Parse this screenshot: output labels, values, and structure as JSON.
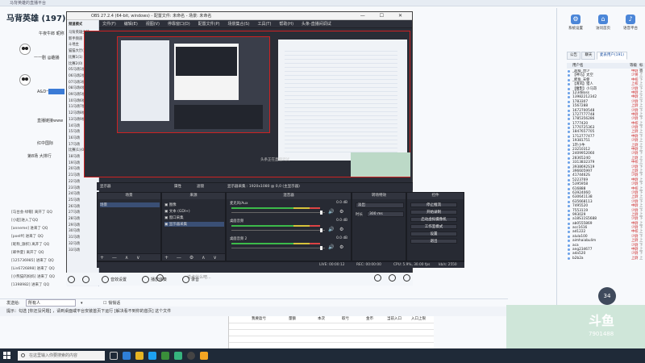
{
  "chat": {
    "window_title": "马背英雄的直播平台",
    "room_title": "马背英雄 (197)",
    "messages": [
      "午夜牛郎 昵称",
      "一一剧 @趣播",
      "A&D一剧",
      "直播链接www",
      "红中国际",
      "第8场 大排行"
    ],
    "logs": [
      "[马台会·绿帽] 离开了 QQ",
      "[小超]进入了QQ",
      "[anneme] 进来了 QQ",
      "[poelff] 进来了 QQ",
      "[昵称_旗帜] 离开了 QQ",
      "[邮件夏] 离开了 QQ",
      "[125736985] 进来了 QQ",
      "[Lin6726898] 进来了 QQ",
      "[小熊猫的妈妈] 进来了 QQ",
      "[1398982] 进来了 QQ"
    ],
    "send_to_label": "发送给:",
    "send_to_value": "所有人",
    "private_label": "悄悄话",
    "tip": "提示：勾选 [你还没问题] ，请到桌面或平台安装首页下运行 [解决看不到你的首页] 这个文件",
    "input_placeholder": "说点什么吧..."
  },
  "toolbar": {
    "tools": [
      "表情",
      "图片",
      "截屏",
      "礼物",
      "麦克风",
      "音效设置",
      "播放伴奏",
      "录音"
    ]
  },
  "right_panel": {
    "icons": [
      "系统设置",
      "访问首页",
      "语音平台"
    ],
    "tabs": [
      "公告",
      "聊天",
      "麦表用户(191)"
    ],
    "headers": [
      "用户名",
      "等级",
      "标签"
    ],
    "users": [
      {
        "name": "_超级_昆少",
        "level": "中尉",
        "tag": "上"
      },
      {
        "name": "【神马】太空",
        "level": "少将",
        "tag": "上"
      },
      {
        "name": "_鳄鱼_天使",
        "level": "中校",
        "tag": "下"
      },
      {
        "name": "【清风】猎人",
        "level": "上校",
        "tag": "上"
      },
      {
        "name": "【魔影】小马哥",
        "level": "少尉",
        "tag": "下"
      },
      {
        "name": "1234Boss",
        "level": "中尉",
        "tag": "上"
      },
      {
        "name": "13982212342",
        "level": "中尉",
        "tag": "上"
      },
      {
        "name": "1783307",
        "level": "少尉",
        "tag": "下"
      },
      {
        "name": "1567288",
        "level": "上尉",
        "tag": "上"
      },
      {
        "name": "1672700548",
        "level": "少尉",
        "tag": "下"
      },
      {
        "name": "1727777748",
        "level": "中尉",
        "tag": "上"
      },
      {
        "name": "1785356286",
        "level": "少尉",
        "tag": "下"
      },
      {
        "name": "1777420",
        "level": "中校",
        "tag": "上"
      },
      {
        "name": "1770725363",
        "level": "少尉",
        "tag": "下"
      },
      {
        "name": "1847657705",
        "level": "上尉",
        "tag": "上"
      },
      {
        "name": "1712777477",
        "level": "中尉",
        "tag": "下"
      },
      {
        "name": "19381751",
        "level": "少尉",
        "tag": "上"
      },
      {
        "name": "1吓小牛",
        "level": "上尉",
        "tag": "上"
      },
      {
        "name": "23210312",
        "level": "中尉",
        "tag": "上"
      },
      {
        "name": "2409952060",
        "level": "少尉",
        "tag": "下"
      },
      {
        "name": "2836524O",
        "level": "上尉",
        "tag": "上"
      },
      {
        "name": "3313832379",
        "level": "中校",
        "tag": "上"
      },
      {
        "name": "3938692S19",
        "level": "少尉",
        "tag": "下"
      },
      {
        "name": "396605997",
        "level": "上尉",
        "tag": "上"
      },
      {
        "name": "4174462S",
        "level": "少尉",
        "tag": "下"
      },
      {
        "name": "5223769",
        "level": "中尉",
        "tag": "上"
      },
      {
        "name": "5395958",
        "level": "少尉",
        "tag": "下"
      },
      {
        "name": "616888",
        "level": "中校",
        "tag": "上"
      },
      {
        "name": "6392406O",
        "level": "少尉",
        "tag": "下"
      },
      {
        "name": "630641138",
        "level": "上尉",
        "tag": "上"
      },
      {
        "name": "635668113",
        "level": "少尉",
        "tag": "下"
      },
      {
        "name": "7495520",
        "level": "中尉",
        "tag": "上"
      },
      {
        "name": "7553119",
        "level": "少尉",
        "tag": "下"
      },
      {
        "name": "993029",
        "level": "上尉",
        "tag": "上"
      },
      {
        "name": "a18S11S5688",
        "level": "少尉",
        "tag": "下"
      },
      {
        "name": "ab0555869",
        "level": "中尉",
        "tag": "上"
      },
      {
        "name": "acc1616",
        "level": "少尉",
        "tag": "下"
      },
      {
        "name": "ad1222",
        "level": "中校",
        "tag": "上"
      },
      {
        "name": "alula100",
        "level": "少尉",
        "tag": "下"
      },
      {
        "name": "aimhaiabulim",
        "level": "上尉",
        "tag": "上"
      },
      {
        "name": "aca",
        "level": "少尉",
        "tag": "下"
      },
      {
        "name": "ang234677",
        "level": "中尉",
        "tag": "上"
      },
      {
        "name": "ada520",
        "level": "少尉",
        "tag": "下"
      },
      {
        "name": "b2b2a",
        "level": "上尉",
        "tag": "上"
      }
    ],
    "float_avatar": "34"
  },
  "obs": {
    "title": "OBS 27.2.4 (64-bit, windows) - 配置文件: 未命名 - 场景: 未命名",
    "menus": [
      "文件(F)",
      "编辑(E)",
      "视图(V)",
      "停靠窗口(D)",
      "配置文件(P)",
      "场景集合(S)",
      "工具(T)",
      "帮助(H)",
      "头条-直播间调试"
    ],
    "scene_bar": {
      "properties": "属性",
      "filters": "滤镜",
      "scene_label": "显示器",
      "info": "显示器采集 : 1920x1080 @ 0,0 (主显示器)"
    },
    "docks": {
      "scenes": {
        "title": "场景",
        "items": [
          "场景"
        ]
      },
      "sources": {
        "title": "来源",
        "items": [
          "图像",
          "文本 (GDI+)",
          "窗口采集",
          "显示器采集"
        ]
      },
      "mixer": {
        "title": "混音器",
        "channels": [
          {
            "label": "麦克风/Aux",
            "db": "0.0 dB"
          },
          {
            "label": "桌面音频",
            "db": "0.0 dB"
          },
          {
            "label": "桌面音频 2",
            "db": "0.0 dB"
          }
        ]
      },
      "transitions": {
        "title": "转场特效",
        "type": "淡出",
        "duration_label": "时长",
        "duration": "300 ms"
      },
      "controls": {
        "title": "控件",
        "buttons": [
          "停止推流",
          "开始录制",
          "启动虚拟摄像机",
          "工作室模式",
          "设置",
          "退出"
        ]
      }
    },
    "status": {
      "live": "LIVE: 00:00:12",
      "rec": "REC: 00:00:00",
      "cpu": "CPU: 5.9%, 30.00 fps",
      "kbps": "kb/s: 2550"
    },
    "preview_caption": "头条正在直播调试"
  },
  "left_tree": {
    "header": "频道模式",
    "items": [
      "马背英雄坐镇",
      "新手频道",
      "斗地主",
      "猫猫大厅(191)",
      "比赛1(1)",
      "比赛2(0)",
      "05马场1组",
      "06马场2组",
      "07马场3组",
      "08马场4组",
      "09马场5组",
      "10马场6组",
      "11马场7组",
      "12马场8组",
      "13马场9组",
      "14马场",
      "15马场",
      "16马场",
      "17马场",
      "比赛(1)(0)",
      "18马场",
      "19马场",
      "20马场",
      "21马场",
      "22马场",
      "23马场",
      "24马场",
      "25马场",
      "26马场",
      "27马场",
      "28马场",
      "29马场",
      "30马场",
      "31马场",
      "32马场",
      "33马场"
    ]
  },
  "spreadsheet": {
    "headers": [
      "我要盈亏",
      "量额",
      "本次",
      "取亏",
      "金币",
      "当前入口",
      "入口上限"
    ]
  },
  "video_overlay": {
    "logo": "斗鱼",
    "number": "7901488"
  },
  "taskbar": {
    "search_placeholder": "在这里输入你要搜索的内容"
  }
}
